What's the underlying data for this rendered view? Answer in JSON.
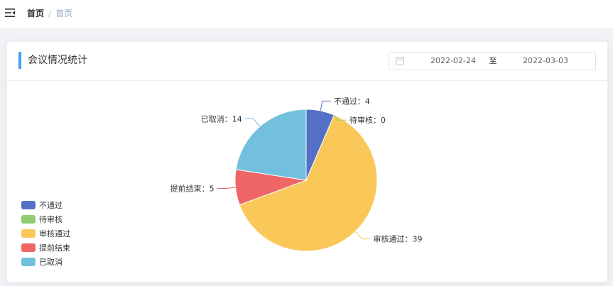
{
  "breadcrumb": {
    "home": "首页",
    "separator": "/",
    "current": "首页"
  },
  "card": {
    "title": "会议情况统计"
  },
  "date_range": {
    "start": "2022-02-24",
    "separator": "至",
    "end": "2022-03-03"
  },
  "icons": {
    "menu": "menu-fold-icon",
    "calendar": "calendar-icon"
  },
  "colors": {
    "accent": "#409eff"
  },
  "chart_data": {
    "type": "pie",
    "title": "",
    "legend_position": "bottom-left",
    "categories": [
      "不通过",
      "待审核",
      "审核通过",
      "提前结束",
      "已取消"
    ],
    "values": [
      4,
      0,
      39,
      5,
      14
    ],
    "colors": [
      "#5470c6",
      "#91cc75",
      "#fac858",
      "#ee6666",
      "#73c0de"
    ],
    "label_separator": "："
  }
}
